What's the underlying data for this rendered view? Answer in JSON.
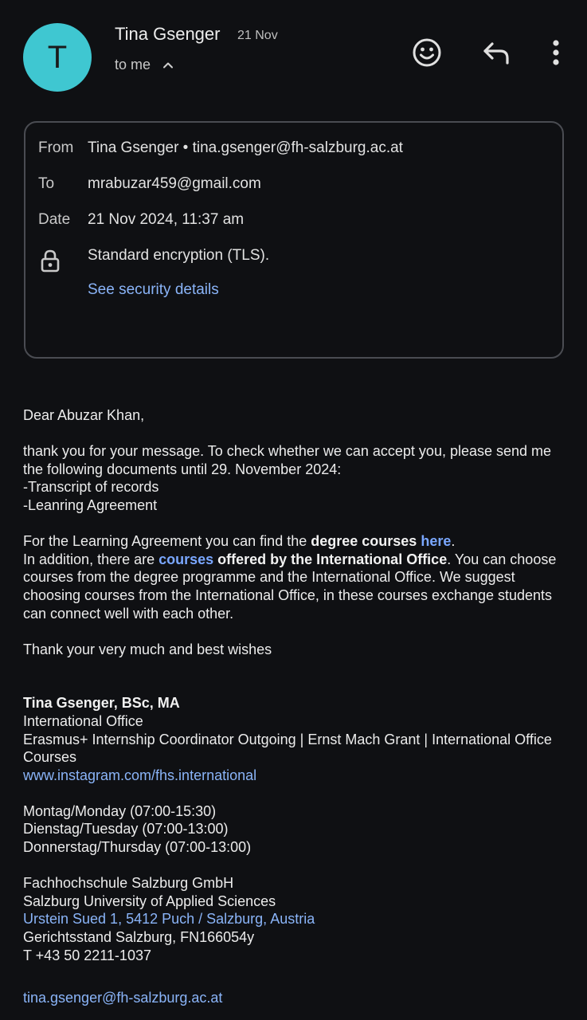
{
  "header": {
    "avatar_letter": "T",
    "sender_name": "Tina Gsenger",
    "date": "21 Nov",
    "to_label": "to me"
  },
  "details": {
    "from_label": "From",
    "from_value": "Tina Gsenger • tina.gsenger@fh-salzburg.ac.at",
    "to_label": "To",
    "to_value": "mrabuzar459@gmail.com",
    "date_label": "Date",
    "date_value": "21 Nov 2024, 11:37 am",
    "encryption": "Standard encryption (TLS).",
    "security_link": "See security details"
  },
  "body": {
    "greeting": "Dear Abuzar Khan,",
    "para1": "thank you for your message. To check whether we can accept you, please send me the following documents until  29. November 2024:",
    "item1": "-Transcript of records",
    "item2": "-Leanring Agreement",
    "la_prefix": "For the Learning Agreement you can find the ",
    "la_bold": "degree courses",
    "la_space": " ",
    "la_link": "here",
    "la_end": ".",
    "add_prefix": "In addition, there are ",
    "add_link": "courses",
    "add_bold": " offered by the International Office",
    "add_rest": ". You can choose courses from the degree programme and the International Office. We suggest choosing courses from the International Office, in these courses exchange students can connect well with each other.",
    "closing": "Thank your very much and best wishes"
  },
  "signature": {
    "name": "Tina Gsenger, BSc, MA",
    "dept": "International Office",
    "role": "Erasmus+ Internship Coordinator Outgoing | Ernst Mach Grant | International Office Courses",
    "instagram": "www.instagram.com/fhs.international",
    "hours1": "Montag/Monday (07:00-15:30)",
    "hours2": "Dienstag/Tuesday (07:00-13:00)",
    "hours3": "Donnerstag/Thursday (07:00-13:00)",
    "org1": "Fachhochschule Salzburg GmbH",
    "org2": "Salzburg University of Applied Sciences",
    "address": "Urstein Sued 1, 5412 Puch / Salzburg, Austria",
    "court": "Gerichtsstand Salzburg, FN166054y",
    "phone": "T +43 50 2211-1037",
    "email": "tina.gsenger@fh-salzburg.ac.at"
  },
  "colors": {
    "background": "#0f1013",
    "avatar": "#3fc7d1",
    "link": "#8ab4f8"
  },
  "icons": [
    "chevron-up-icon",
    "emoji-icon",
    "reply-icon",
    "more-vert-icon",
    "lock-icon"
  ]
}
